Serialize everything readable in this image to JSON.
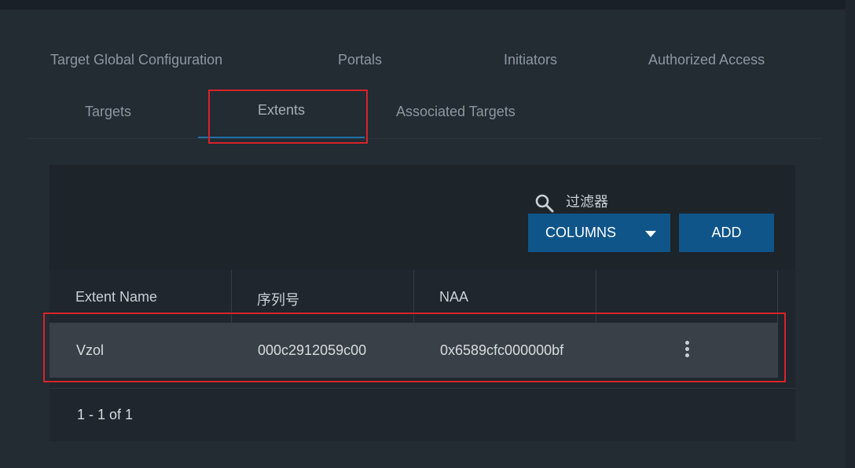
{
  "tabs": {
    "target_global_configuration": "Target Global Configuration",
    "portals": "Portals",
    "initiators": "Initiators",
    "authorized_access": "Authorized Access",
    "targets": "Targets",
    "extents": "Extents",
    "associated_targets": "Associated Targets",
    "active": "Extents"
  },
  "toolbar": {
    "filter_label": "过滤器",
    "columns_label": "COLUMNS",
    "add_label": "ADD"
  },
  "table": {
    "columns": [
      "Extent Name",
      "序列号",
      "NAA",
      ""
    ],
    "rows": [
      {
        "extent_name": "Vzol",
        "serial": "000c2912059c00",
        "naa": "0x6589cfc000000bf"
      }
    ]
  },
  "pagination": {
    "text": "1 - 1 of 1"
  },
  "colors": {
    "accent": "#0f5589",
    "highlight": "#d8232a",
    "tab_underline": "#1e6fa6"
  },
  "icons": [
    "search-icon",
    "chevron-down-icon",
    "more-vertical-icon"
  ]
}
